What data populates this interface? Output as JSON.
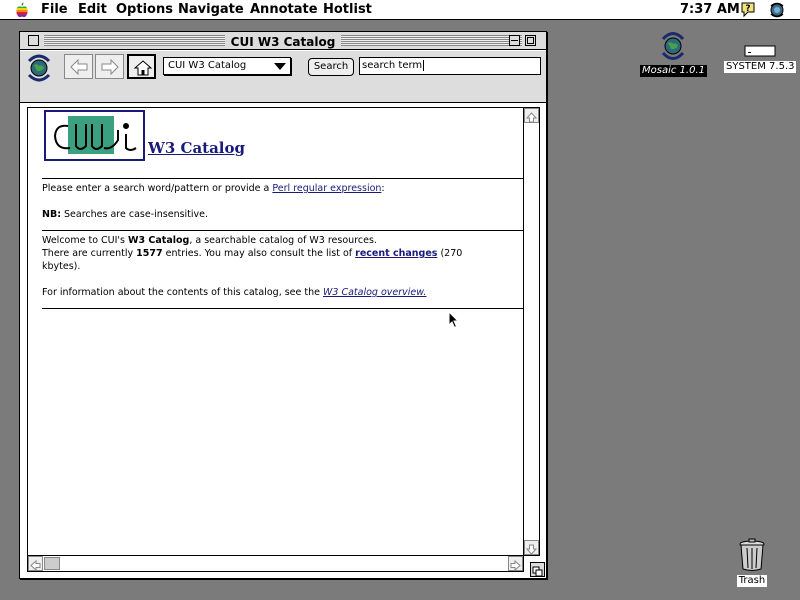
{
  "menubar": {
    "items": [
      "File",
      "Edit",
      "Options",
      "Navigate",
      "Annotate",
      "Hotlist"
    ],
    "clock": "7:37 AM"
  },
  "desktop": {
    "mosaic_label": "Mosaic 1.0.1",
    "system_label": "SYSTEM 7.5.3",
    "trash_label": "Trash"
  },
  "window": {
    "title": "CUI W3 Catalog"
  },
  "toolbar": {
    "url_selected": "CUI W3 Catalog",
    "search_label": "Search",
    "search_value": "search term"
  },
  "doc": {
    "logo_text": "cui",
    "title": "W3 Catalog",
    "p1_prefix": "Please enter a search word/pattern or provide a ",
    "p1_link": "Perl regular expression",
    "p1_suffix": ":",
    "nb_label": "NB:",
    "nb_text": " Searches are case-insensitive.",
    "w1_prefix": "Welcome to CUI's ",
    "w1_bold": "W3 Catalog",
    "w1_suffix": ", a searchable catalog of W3 resources.",
    "w2_prefix": "There are currently ",
    "w2_count": "1577",
    "w2_mid": " entries. You may also consult the list of ",
    "w2_link": "recent changes",
    "w2_suffix": " (270",
    "w3_text": "kbytes).",
    "info_prefix": "For information about the contents of this catalog, see the ",
    "info_link": "W3 Catalog overview."
  },
  "colors": {
    "link": "#1a1a7a",
    "desktop": "#7b7b7b"
  }
}
